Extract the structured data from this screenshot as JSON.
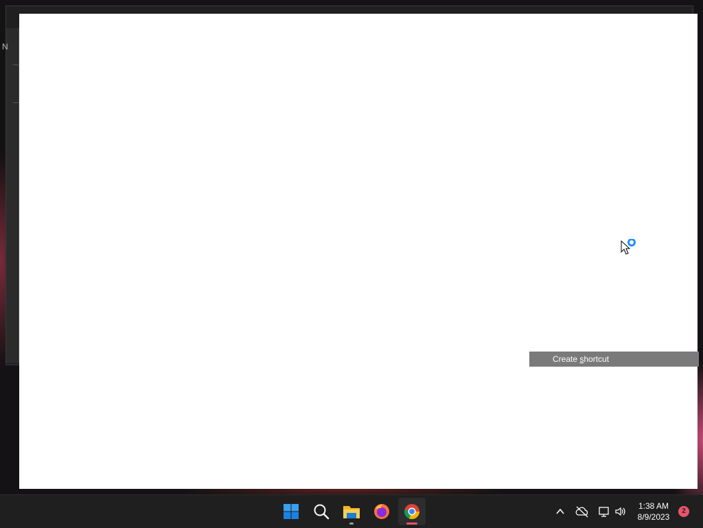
{
  "background_window": {
    "edge_letter": "N"
  },
  "context_menu": {
    "item_prefix": "Create ",
    "item_accel": "s",
    "item_suffix": "hortcut"
  },
  "taskbar": {
    "apps": [
      {
        "name": "Start",
        "icon": "windows-logo-icon"
      },
      {
        "name": "Search",
        "icon": "search-icon"
      },
      {
        "name": "File Explorer",
        "icon": "folder-icon"
      },
      {
        "name": "Firefox",
        "icon": "firefox-icon"
      },
      {
        "name": "Google Chrome",
        "icon": "chrome-icon"
      }
    ],
    "tray": {
      "time": "1:38 AM",
      "date": "8/9/2023",
      "notification_count": "2"
    }
  },
  "colors": {
    "accent": "#0078d4",
    "taskbar": "#1f1f1f",
    "menu_highlight": "#7a7a7a",
    "badge": "#e8556a"
  }
}
